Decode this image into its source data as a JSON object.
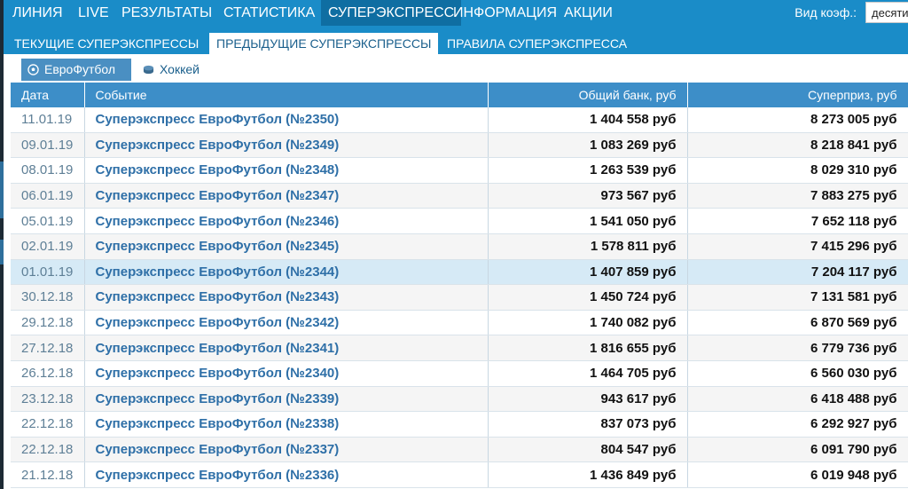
{
  "topnav": {
    "items": [
      {
        "label": "ЛИНИЯ"
      },
      {
        "label": "LIVE"
      },
      {
        "label": "РЕЗУЛЬТАТЫ"
      },
      {
        "label": "СТАТИСТИКА"
      },
      {
        "label": "СУПЕРЭКСПРЕСС"
      },
      {
        "label": "ИНФОРМАЦИЯ"
      },
      {
        "label": "АКЦИИ"
      }
    ],
    "coef_label": "Вид коэф.:",
    "coef_value": "десяти"
  },
  "subtabs": [
    {
      "label": "ТЕКУЩИЕ СУПЕРЭКСПРЕССЫ"
    },
    {
      "label": "ПРЕДЫДУЩИЕ СУПЕРЭКСПРЕССЫ"
    },
    {
      "label": "ПРАВИЛА СУПЕРЭКСПРЕССА"
    }
  ],
  "sports": [
    {
      "label": "ЕвроФутбол",
      "icon": "soccer-ball-icon"
    },
    {
      "label": "Хоккей",
      "icon": "hockey-puck-icon"
    }
  ],
  "table": {
    "headers": {
      "date": "Дата",
      "event": "Событие",
      "bank": "Общий банк, руб",
      "prize": "Суперприз, руб"
    },
    "rows": [
      {
        "date": "11.01.19",
        "event": "Суперэкспресс ЕвроФутбол (№2350)",
        "bank": "1 404 558 руб",
        "prize": "8 273 005 руб"
      },
      {
        "date": "09.01.19",
        "event": "Суперэкспресс ЕвроФутбол (№2349)",
        "bank": "1 083 269 руб",
        "prize": "8 218 841 руб"
      },
      {
        "date": "08.01.19",
        "event": "Суперэкспресс ЕвроФутбол (№2348)",
        "bank": "1 263 539 руб",
        "prize": "8 029 310 руб"
      },
      {
        "date": "06.01.19",
        "event": "Суперэкспресс ЕвроФутбол (№2347)",
        "bank": "973 567 руб",
        "prize": "7 883 275 руб"
      },
      {
        "date": "05.01.19",
        "event": "Суперэкспресс ЕвроФутбол (№2346)",
        "bank": "1 541 050 руб",
        "prize": "7 652 118 руб"
      },
      {
        "date": "02.01.19",
        "event": "Суперэкспресс ЕвроФутбол (№2345)",
        "bank": "1 578 811 руб",
        "prize": "7 415 296 руб"
      },
      {
        "date": "01.01.19",
        "event": "Суперэкспресс ЕвроФутбол (№2344)",
        "bank": "1 407 859 руб",
        "prize": "7 204 117 руб"
      },
      {
        "date": "30.12.18",
        "event": "Суперэкспресс ЕвроФутбол (№2343)",
        "bank": "1 450 724 руб",
        "prize": "7 131 581 руб"
      },
      {
        "date": "29.12.18",
        "event": "Суперэкспресс ЕвроФутбол (№2342)",
        "bank": "1 740 082 руб",
        "prize": "6 870 569 руб"
      },
      {
        "date": "27.12.18",
        "event": "Суперэкспресс ЕвроФутбол (№2341)",
        "bank": "1 816 655 руб",
        "prize": "6 779 736 руб"
      },
      {
        "date": "26.12.18",
        "event": "Суперэкспресс ЕвроФутбол (№2340)",
        "bank": "1 464 705 руб",
        "prize": "6 560 030 руб"
      },
      {
        "date": "23.12.18",
        "event": "Суперэкспресс ЕвроФутбол (№2339)",
        "bank": "943 617 руб",
        "prize": "6 418 488 руб"
      },
      {
        "date": "22.12.18",
        "event": "Суперэкспресс ЕвроФутбол (№2338)",
        "bank": "837 073 руб",
        "prize": "6 292 927 руб"
      },
      {
        "date": "22.12.18",
        "event": "Суперэкспресс ЕвроФутбол (№2337)",
        "bank": "804 547 руб",
        "prize": "6 091 790 руб"
      },
      {
        "date": "21.12.18",
        "event": "Суперэкспресс ЕвроФутбол (№2336)",
        "bank": "1 436 849 руб",
        "prize": "6 019 948 руб"
      }
    ]
  },
  "colors": {
    "nav_bg": "#1a8cc8",
    "nav_active_bg": "#0f6ea2",
    "table_header_bg": "#3d8ec8",
    "link": "#2e6fa7",
    "row_highlight": "#d6eaf6"
  }
}
